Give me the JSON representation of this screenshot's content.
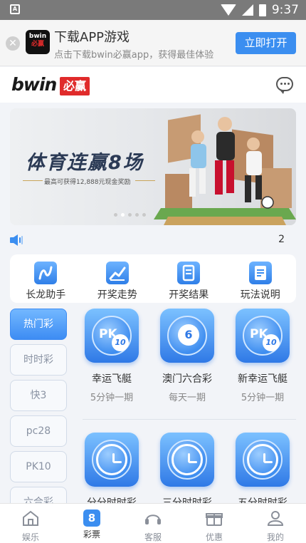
{
  "status_bar": {
    "time": "9:37",
    "left_badge": "A"
  },
  "download_banner": {
    "title": "下载APP游戏",
    "subtitle": "点击下载bwin必赢app，获得最佳体验",
    "button": "立即打开",
    "logo_top": "bwin",
    "logo_bottom": "必赢"
  },
  "header": {
    "logo_text": "bwin",
    "logo_cn": "必赢",
    "chat_icon": "chat-bubble-icon"
  },
  "hero": {
    "title": "体育连赢8场",
    "subtitle": "最高可获得12,888元现金奖励",
    "slide_count": 5,
    "active_slide": 1
  },
  "notice": {
    "speaker_icon": "speaker-icon",
    "trailing_text": "2"
  },
  "quick_menu": [
    {
      "label": "长龙助手",
      "icon": "dragon-icon"
    },
    {
      "label": "开奖走势",
      "icon": "trend-chart-icon"
    },
    {
      "label": "开奖结果",
      "icon": "results-document-icon"
    },
    {
      "label": "玩法说明",
      "icon": "rules-document-icon"
    }
  ],
  "categories": [
    {
      "label": "热门彩",
      "active": true
    },
    {
      "label": "时时彩",
      "active": false
    },
    {
      "label": "快3",
      "active": false
    },
    {
      "label": "pc28",
      "active": false
    },
    {
      "label": "PK10",
      "active": false
    },
    {
      "label": "六合彩",
      "active": false
    }
  ],
  "games": [
    {
      "name": "幸运飞艇",
      "desc": "5分钟一期",
      "icon": "pk10-icon",
      "pk": "PK",
      "badge": "10"
    },
    {
      "name": "澳门六合彩",
      "desc": "每天一期",
      "icon": "lottery-ball-6-icon",
      "ball": "6"
    },
    {
      "name": "新幸运飞艇",
      "desc": "5分钟一期",
      "icon": "pk10-icon",
      "pk": "PK",
      "badge": "10"
    },
    {
      "name": "分分时时彩",
      "desc": "",
      "icon": "clock-icon"
    },
    {
      "name": "三分时时彩",
      "desc": "",
      "icon": "clock-icon"
    },
    {
      "name": "五分时时彩",
      "desc": "",
      "icon": "clock-icon"
    }
  ],
  "tabs": [
    {
      "label": "娱乐",
      "icon": "home-icon",
      "active": false
    },
    {
      "label": "彩票",
      "icon": "lottery-8-icon",
      "active": true,
      "glyph": "8"
    },
    {
      "label": "客服",
      "icon": "headset-icon",
      "active": false
    },
    {
      "label": "优惠",
      "icon": "gift-icon",
      "active": false
    },
    {
      "label": "我的",
      "icon": "user-icon",
      "active": false
    }
  ],
  "colors": {
    "accent": "#3b8ef0",
    "brand_red": "#e02b2b",
    "background": "#f2f4f8"
  }
}
